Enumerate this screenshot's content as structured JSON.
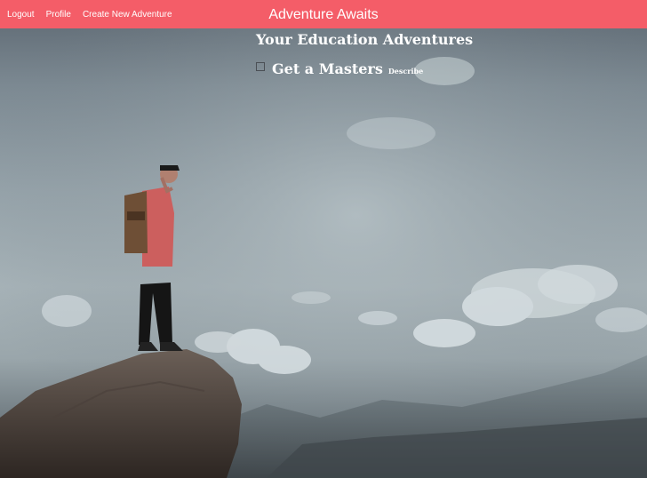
{
  "navbar": {
    "links": [
      "Logout",
      "Profile",
      "Create New Adventure"
    ],
    "brand": "Adventure Awaits",
    "color": "#f45d68"
  },
  "main": {
    "heading": "Your Education Adventures",
    "items": [
      {
        "title": "Get a Masters",
        "action_label": "Describe",
        "checked": false
      }
    ]
  },
  "background": {
    "description_icon": "hiker-on-cliff-photo"
  }
}
